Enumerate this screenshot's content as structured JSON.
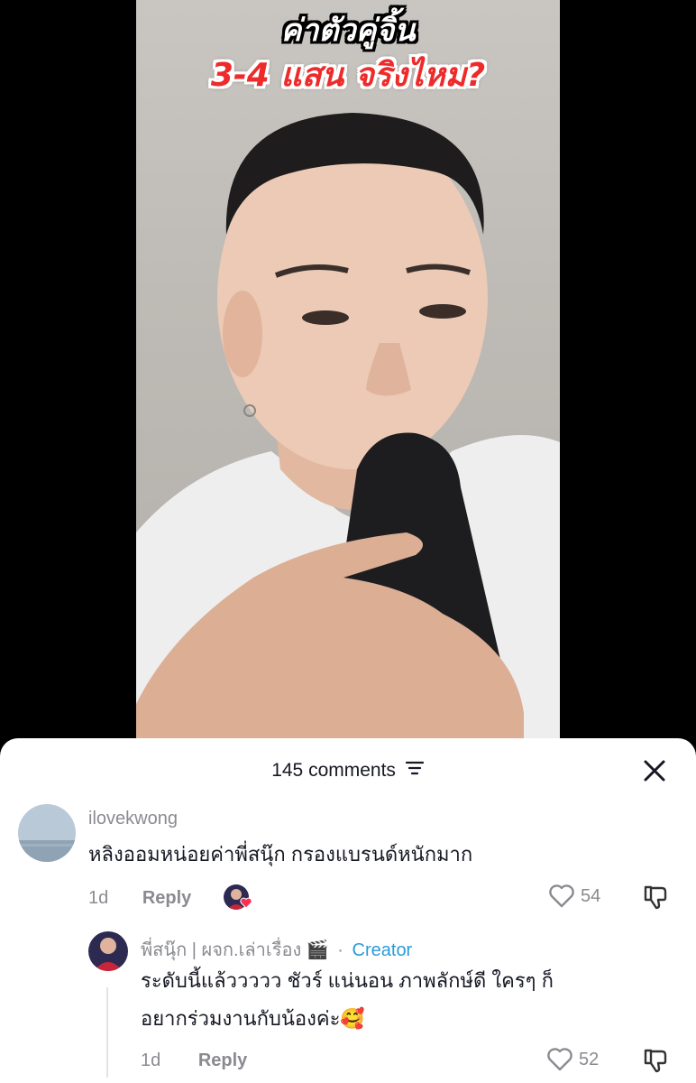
{
  "video": {
    "overlay_line1": "ค่าตัวคู่จิ้น",
    "overlay_line2": "3-4 แสน จริงไหม?"
  },
  "comments_header": {
    "count_label": "145 comments"
  },
  "comments": [
    {
      "username": "ilovekwong",
      "text": "หลิงออมหน่อยค่าพี่สนุ๊ก กรองแบรนด์หนักมาก",
      "time": "1d",
      "reply_label": "Reply",
      "likes": "54"
    },
    {
      "username": "พี่สนุ๊ก | ผจก.เล่าเรื่อง 🎬",
      "separator": "·",
      "creator_label": "Creator",
      "text_line1": "ระดับนี้แล้ววววว ชัวร์ แน่นอน ภาพลักษ์ดี ใครๆ ก็",
      "text_line2": "อยากร่วมงานกับน้องค่ะ🥰",
      "time": "1d",
      "reply_label": "Reply",
      "likes": "52"
    }
  ],
  "colors": {
    "sheet_bg": "#ffffff",
    "text_primary": "#161823",
    "text_secondary": "#8a8b91",
    "creator_blue": "#2b9bd9",
    "overlay_red": "#ee2b2b"
  }
}
